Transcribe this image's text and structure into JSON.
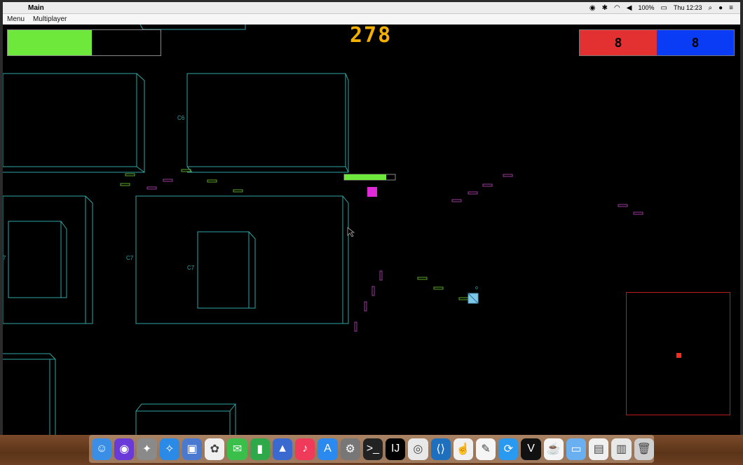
{
  "menubar": {
    "app_name": "Main",
    "clock": "Thu 12:23",
    "battery": "100%"
  },
  "app_menu": {
    "items": [
      "Menu",
      "Multiplayer"
    ]
  },
  "hud": {
    "score": "278",
    "health_fraction": 0.55,
    "red_team_score": "8",
    "blue_team_score": "8",
    "colors": {
      "health": "#6ee83a",
      "score": "#f4b000",
      "red_team": "#e33030",
      "blue_team": "#0b3cf5",
      "wireframe": "#2fa5a5",
      "player": "#e02ad8",
      "minimap": "#b81c1c"
    }
  },
  "map": {
    "building_labels": [
      "C6",
      "C7",
      "C7",
      "7"
    ]
  },
  "minimap": {
    "player_marker": "red-dot"
  },
  "dock": {
    "icons": [
      "finder-icon",
      "siri-icon",
      "launchpad-icon",
      "safari-icon",
      "preview-icon",
      "photos-icon",
      "messages-icon",
      "numbers-icon",
      "keynote-icon",
      "music-icon",
      "appstore-icon",
      "system-preferences-icon",
      "terminal-icon",
      "intellij-icon",
      "chrome-icon",
      "vscode-icon",
      "hand-icon",
      "textedit-icon",
      "sync-icon",
      "vectorworks-icon",
      "java-icon",
      "folder-icon",
      "documents-icon",
      "files-icon",
      "trash-icon"
    ]
  }
}
